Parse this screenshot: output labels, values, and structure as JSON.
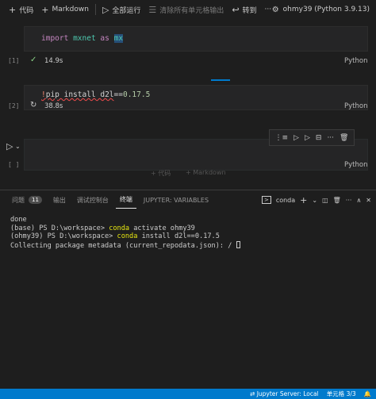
{
  "toolbar": {
    "code_label": "代码",
    "markdown_label": "Markdown",
    "run_all_label": "全部运行",
    "clear_outputs_label": "清除所有单元格输出",
    "goto_label": "转到",
    "kernel_label": "ohmy39 (Python 3.9.13)"
  },
  "cells": [
    {
      "count": "[1]",
      "lang": "Python",
      "status": "check",
      "time": "14.9s"
    },
    {
      "count": "[2]",
      "lang": "Python",
      "status": "running",
      "time": "38.8s"
    },
    {
      "count": "[ ]",
      "lang": "Python"
    }
  ],
  "code": {
    "c1_kw1": "import",
    "c1_mod": "mxnet",
    "c1_kw2": "as",
    "c1_alias": "mx",
    "c2_bang": "!",
    "c2_text": "pip install d2l",
    "c2_op": "==",
    "c2_ver": "0.17.5"
  },
  "insert": {
    "code_label": "+ 代码",
    "markdown_label": "+ Markdown"
  },
  "panel": {
    "tabs": [
      "问题",
      "输出",
      "调试控制台",
      "终端",
      "JUPYTER: VARIABLES"
    ],
    "problems_count": "11",
    "active_tab": "终端",
    "terminal_name": "conda"
  },
  "terminal": {
    "l1": "done",
    "l2_prompt": "(base) PS D:\\workspace> ",
    "l2_cmd": "conda",
    "l2_rest": " activate ohmy39",
    "l3_prompt": "(ohmy39) PS D:\\workspace> ",
    "l3_cmd": "conda",
    "l3_rest": " install d2l==0.17.5",
    "l4": "Collecting package metadata (current_repodata.json): / "
  },
  "status": {
    "server": "Jupyter Server: Local",
    "cell_pos": "单元格 3/3"
  },
  "colors": {
    "status_bar": "#007acc",
    "editor_bg": "#1e1e1e",
    "cell_bg": "#252526"
  }
}
